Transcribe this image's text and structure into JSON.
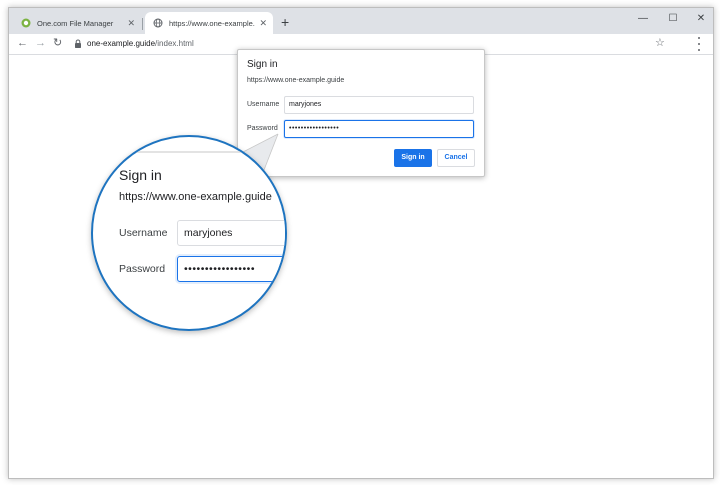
{
  "browser": {
    "tabs": [
      {
        "title": "One.com File Manager",
        "active": false
      },
      {
        "title": "https://www.one-example.guide",
        "active": true
      }
    ],
    "new_tab_label": "+",
    "window_controls": {
      "minimize": "—",
      "maximize": "☐",
      "close": "✕"
    },
    "address": {
      "host": "one-example.guide",
      "path": "/index.html"
    }
  },
  "dialog": {
    "title": "Sign in",
    "origin": "https://www.one-example.guide",
    "username_label": "Username",
    "username_value": "maryjones",
    "password_label": "Password",
    "password_value": "•••••••••••••••••",
    "signin_label": "Sign in",
    "cancel_label": "Cancel"
  },
  "magnifier": {
    "title": "Sign in",
    "origin": "https://www.one-example.guide",
    "username_label": "Username",
    "username_value": "maryjones",
    "password_label": "Password",
    "password_value": "•••••••••••••••••"
  },
  "colors": {
    "accent": "#1a73e8",
    "callout_border": "#1e74c0"
  },
  "icons": {
    "tab1": "onecom-favicon",
    "tab2": "globe-icon",
    "back": "back-arrow-icon",
    "forward": "forward-arrow-icon",
    "reload": "reload-icon",
    "lock": "lock-icon",
    "star": "star-icon",
    "menu": "kebab-menu-icon"
  }
}
